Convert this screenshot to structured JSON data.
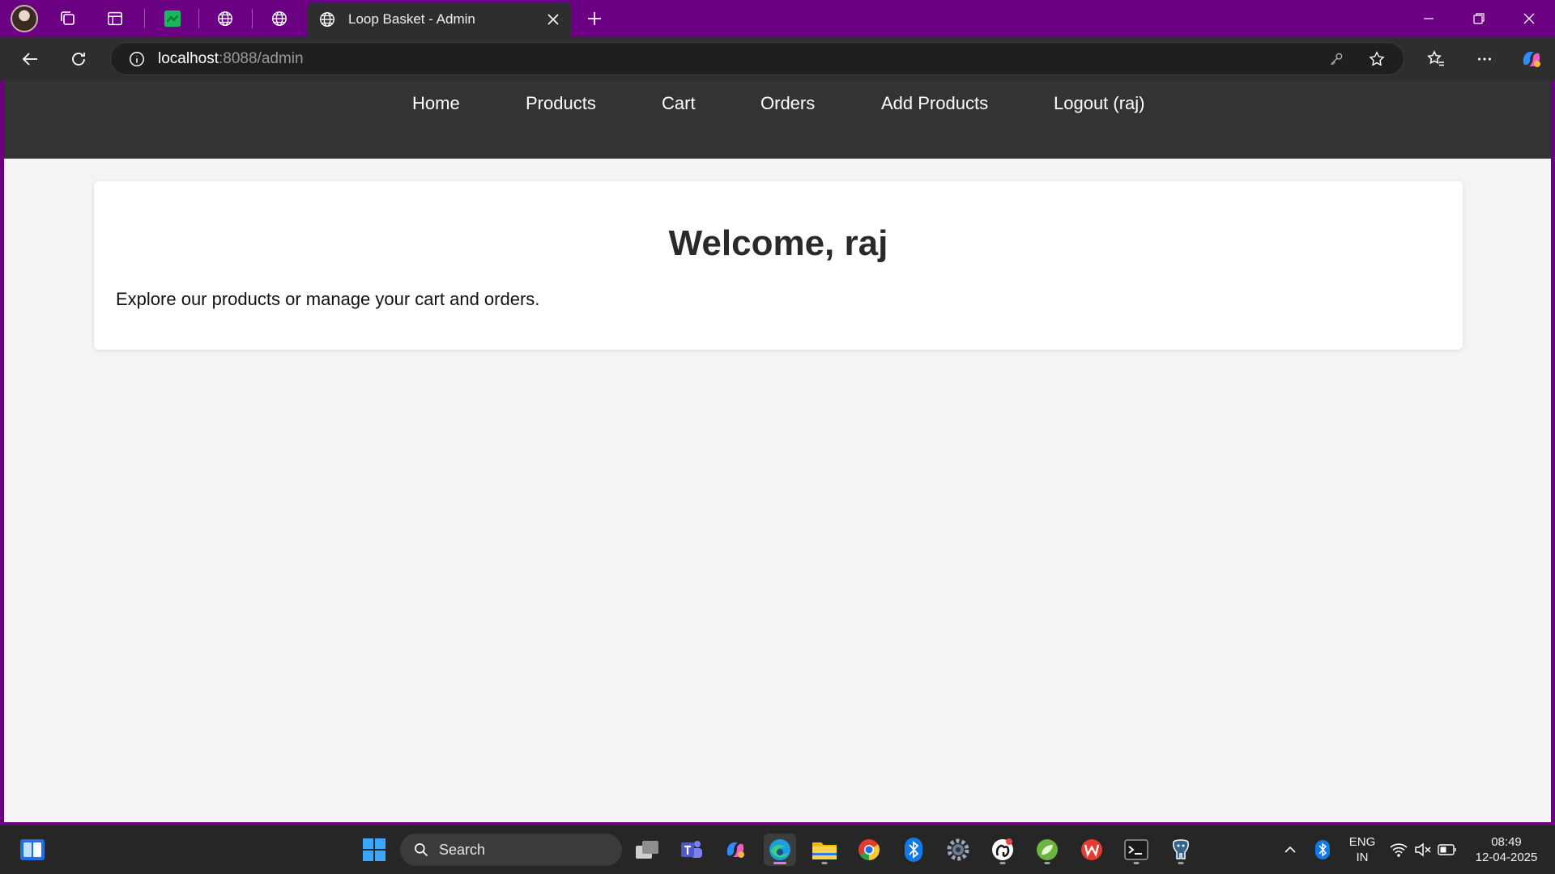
{
  "browser": {
    "active_tab_title": "Loop Basket - Admin",
    "url_host": "localhost",
    "url_rest": ":8088/admin"
  },
  "site": {
    "nav": {
      "home": "Home",
      "products": "Products",
      "cart": "Cart",
      "orders": "Orders",
      "add_products": "Add Products",
      "logout": "Logout (raj)"
    },
    "welcome_title": "Welcome, raj",
    "welcome_text": "Explore our products or manage your cart and orders."
  },
  "taskbar": {
    "search_label": "Search",
    "language_line1": "ENG",
    "language_line2": "IN",
    "time": "08:49",
    "date": "12-04-2025"
  },
  "colors": {
    "tab_strip": "#6c0082",
    "site_nav_bg": "#333333",
    "page_bg": "#f4f4f4",
    "card_bg": "#ffffff"
  }
}
